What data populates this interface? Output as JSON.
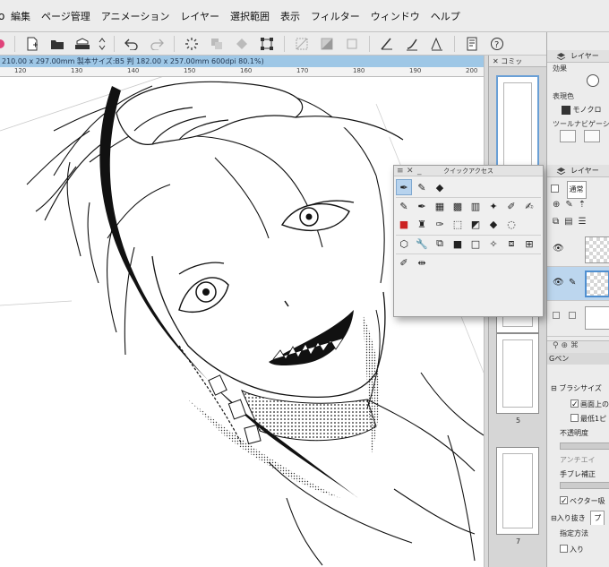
{
  "menu": {
    "app_letter": "o",
    "items": [
      "編集",
      "ページ管理",
      "アニメーション",
      "レイヤー",
      "選択範囲",
      "表示",
      "フィルター",
      "ウィンドウ",
      "ヘルプ"
    ]
  },
  "status": {
    "text": "210.00 x 297.00mm 製本サイズ:B5 判 182.00 x 257.00mm 600dpi 80.1%)"
  },
  "ruler": {
    "labels": [
      "120",
      "130",
      "140",
      "150",
      "160",
      "170",
      "180",
      "190",
      "200"
    ]
  },
  "pages_panel": {
    "title": "コミッ",
    "page_numbers": [
      "5",
      "7"
    ]
  },
  "quick_access": {
    "title": "クイックアクセス"
  },
  "right_panels": {
    "layer_prop_title": "レイヤー",
    "effect_label": "効果",
    "expression_color_label": "表現色",
    "expression_color_value": "モノクロ",
    "tool_nav_label": "ツールナビゲーシ",
    "layer_title": "レイヤー",
    "blend_mode": "通常",
    "brush_name": "Gペン",
    "brush_size_label": "ブラシサイズ",
    "screen_label": "画面上の",
    "min_label": "最低1ピ",
    "opacity_label": "不透明度",
    "antialias_label": "アンチエイ",
    "stabilizer_label": "手ブレ補正",
    "vector_label": "ベクター吸",
    "in_out_label": "入り抜き",
    "in_out_value": "プ",
    "method_label": "指定方法",
    "enter_label": "入り"
  },
  "colors": {
    "accent": "#9ec7e6",
    "selection": "#b7d3ee",
    "panel_bg": "#ececec"
  }
}
